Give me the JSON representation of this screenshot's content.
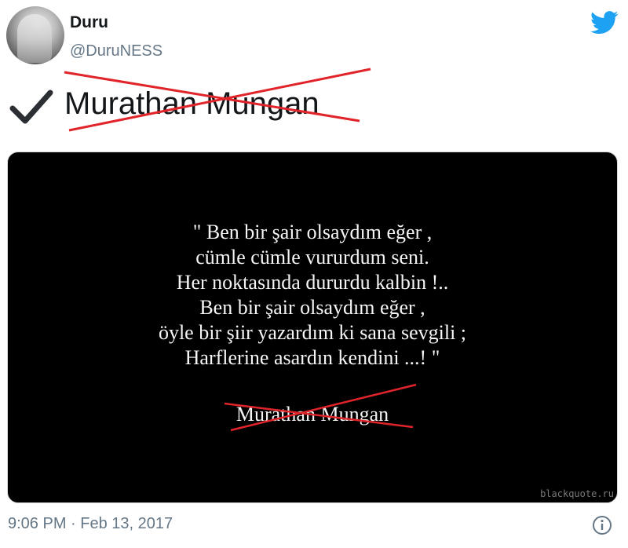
{
  "user": {
    "name": "Duru",
    "handle": "@DuruNESS"
  },
  "tweet": {
    "check_glyph": "✓",
    "text": "Murathan Mungan",
    "strikethrough_color": "#e0242a"
  },
  "media": {
    "quote_lines": [
      "\" Ben bir şair olsaydım eğer ,",
      "cümle cümle vururdum seni.",
      "Her noktasında dururdu kalbin !..",
      "Ben bir şair olsaydım eğer ,",
      "öyle bir şiir yazardım ki sana sevgili ;",
      "Harflerine asardın kendini ...! \""
    ],
    "author": "Murathan Mungan",
    "watermark": "blackquote.ru"
  },
  "footer": {
    "timestamp": "9:06 PM · Feb 13, 2017"
  },
  "icons": {
    "brand": "twitter-bird-icon",
    "info": "info-icon",
    "check": "check-icon"
  },
  "colors": {
    "twitter_blue": "#1da1f2",
    "secondary_text": "#657786",
    "cross_red": "#e0242a"
  }
}
